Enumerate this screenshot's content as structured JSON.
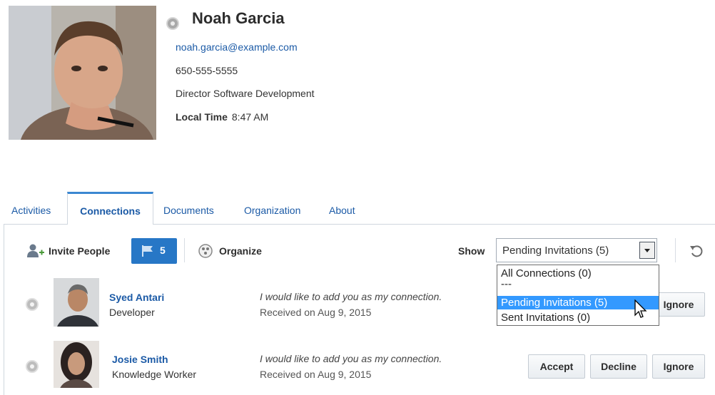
{
  "profile": {
    "name": "Noah Garcia",
    "email": "noah.garcia@example.com",
    "phone": "650-555-5555",
    "title": "Director Software Development",
    "local_time_label": "Local Time",
    "local_time": "8:47 AM"
  },
  "tabs": [
    {
      "label": "Activities"
    },
    {
      "label": "Connections"
    },
    {
      "label": "Documents"
    },
    {
      "label": "Organization"
    },
    {
      "label": "About"
    }
  ],
  "active_tab": "Connections",
  "toolbar": {
    "invite_label": "Invite People",
    "flag_count": "5",
    "organize_label": "Organize",
    "show_label": "Show",
    "show_value": "Pending Invitations (5)"
  },
  "dropdown": {
    "options": [
      "All Connections (0)",
      "---",
      "Pending Invitations (5)",
      "Sent Invitations (0)"
    ],
    "selected": "Pending Invitations (5)"
  },
  "invitations": [
    {
      "name": "Syed Antari",
      "title": "Developer",
      "message": "I would like to add you as my connection.",
      "received": "Received on Aug 9, 2015",
      "actions": [
        "Ignore"
      ]
    },
    {
      "name": "Josie Smith",
      "title": "Knowledge Worker",
      "message": "I would like to add you as my connection.",
      "received": "Received on Aug 9, 2015",
      "actions": [
        "Accept",
        "Decline",
        "Ignore"
      ]
    }
  ],
  "icons": {
    "presence": "presence-status-icon",
    "invite": "add-person-icon",
    "flag": "flag-icon",
    "organize": "organize-icon",
    "refresh": "refresh-icon",
    "cursor": "mouse-pointer-icon"
  },
  "colors": {
    "link": "#1b5aa6",
    "accent": "#2777c6",
    "selection": "#3399ff"
  }
}
